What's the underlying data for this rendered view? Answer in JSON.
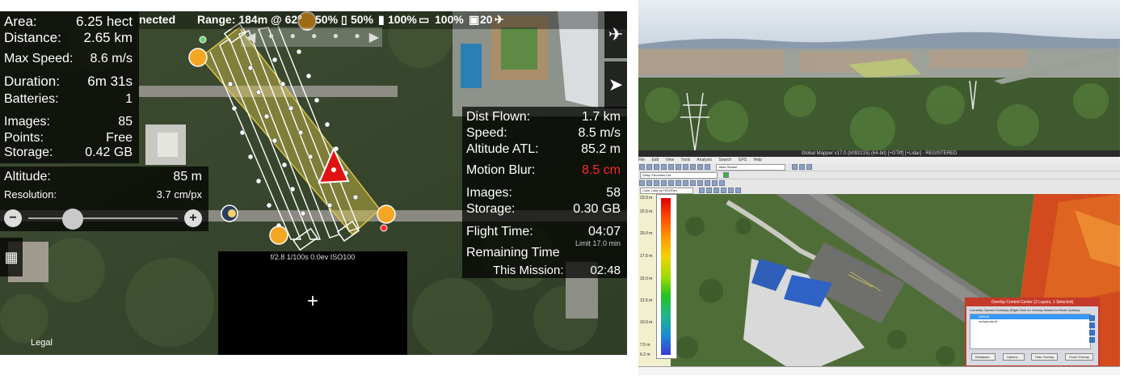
{
  "planner": {
    "top_bar": {
      "status": "nected",
      "range": "Range: 184m @ 62°",
      "aircraft_battery": "50%",
      "phone_battery": "50%",
      "signal1": "100%",
      "signal2": "100%",
      "satellites": "20"
    },
    "stats": [
      {
        "key": "Area:",
        "value": "6.25 hect"
      },
      {
        "key": "Distance:",
        "value": "2.65 km"
      },
      {
        "key": "Max Speed:",
        "value": "8.6 m/s"
      },
      {
        "key": "Duration:",
        "value": "6m 31s"
      },
      {
        "key": "Batteries:",
        "value": "1"
      },
      {
        "key": "Images:",
        "value": "85"
      },
      {
        "key": "Points:",
        "value": "Free"
      },
      {
        "key": "Storage:",
        "value": "0.42 GB"
      }
    ],
    "altitude": {
      "label": "Altitude:",
      "value": "85 m",
      "res_label": "Resolution:",
      "res_value": "3.7 cm/px"
    },
    "flight": [
      {
        "key": "Dist Flown:",
        "value": "1.7 km"
      },
      {
        "key": "Speed:",
        "value": "8.5 m/s"
      },
      {
        "key": "Altitude ATL:",
        "value": "85.2 m"
      },
      {
        "key": "Motion Blur:",
        "value": "8.5 cm"
      },
      {
        "key": "Images:",
        "value": "58"
      },
      {
        "key": "Storage:",
        "value": "0.30 GB"
      },
      {
        "key": "Flight Time:",
        "value": "04:07"
      },
      {
        "key": "Remaining Time",
        "value": ""
      },
      {
        "key": "This Mission:",
        "value": "02:48"
      }
    ],
    "limit": "Limit 17.0 min",
    "camera_exif": "f/2.8 1/100s 0.0ev ISO100",
    "legal": "Legal",
    "colors": {
      "warning": "#ff2a2a",
      "waypoint": "#f5a623",
      "route": "#ffffff",
      "area": "#d7c34a"
    }
  },
  "global_mapper": {
    "title": "Global Mapper v17.0 (b092215) (64-bit) [+GTiff] [+Lidar] - REGISTERED",
    "menus": [
      "File",
      "Edit",
      "View",
      "Tools",
      "Analysis",
      "Search",
      "GPS",
      "Help"
    ],
    "favorites": "Setup Favorites List",
    "shader": "Atlas Shader",
    "lidar_color": "Color Lidar by HSV/Elev",
    "scale_ticks": [
      "23.9 m",
      "22.5 m",
      "20.0 m",
      "17.5 m",
      "15.0 m",
      "12.5 m",
      "10.0 m",
      "7.5 m",
      "6.2 m"
    ],
    "overlay_dialog": {
      "title": "Overlay Control Center (2 Layers, 1 Selected)",
      "hint": "Currently Opened Overlays (Right Click on Overlay Names for More Options)",
      "layers": [
        "DEM.tif",
        "orthophoto.tif"
      ],
      "buttons": [
        "Metadata...",
        "Options...",
        "Hide Overlay",
        "Close Overlay"
      ]
    }
  }
}
